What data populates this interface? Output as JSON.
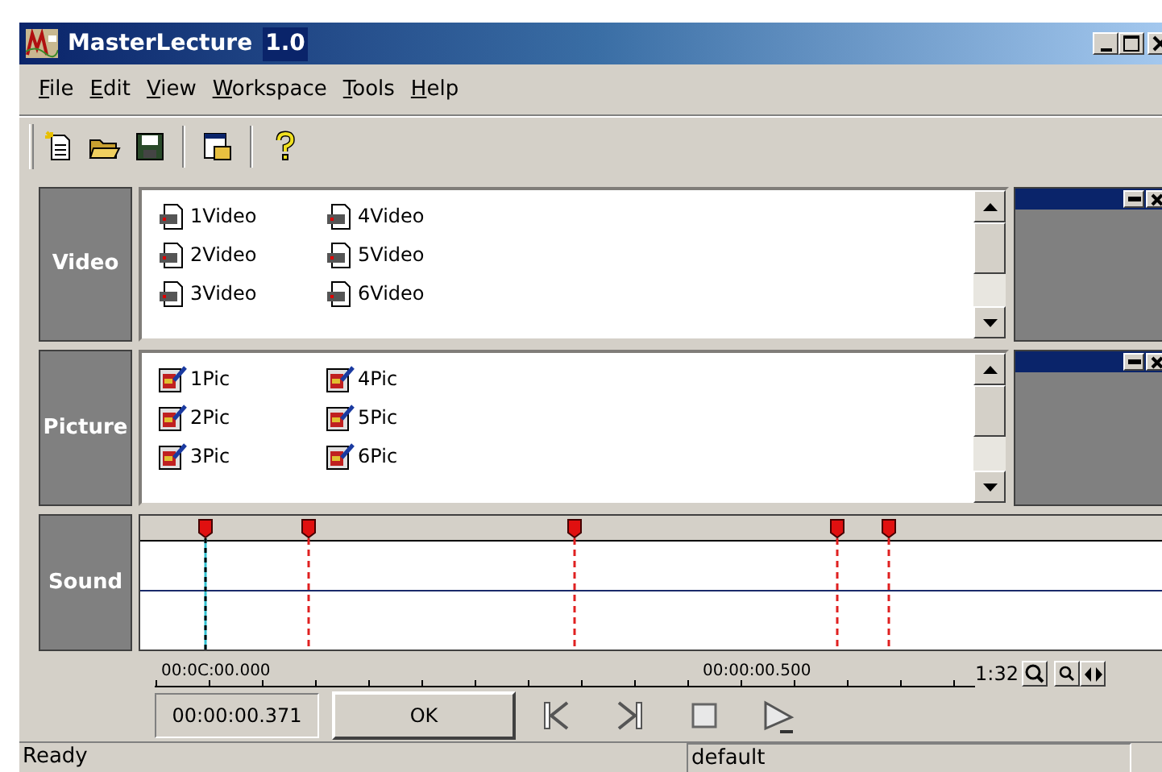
{
  "window": {
    "title": "MasterLecture",
    "version": "1.0"
  },
  "menu": [
    {
      "label": "File"
    },
    {
      "label": "Edit"
    },
    {
      "label": "View"
    },
    {
      "label": "Workspace"
    },
    {
      "label": "Tools"
    },
    {
      "label": "Help"
    }
  ],
  "tracks": [
    {
      "kind": "video",
      "label": "Video",
      "items": [
        "1Video",
        "2Video",
        "3Video",
        "4Video",
        "5Video",
        "6Video"
      ]
    },
    {
      "kind": "picture",
      "label": "Picture",
      "items": [
        "1Pic",
        "2Pic",
        "3Pic",
        "4Pic",
        "5Pic",
        "6Pic"
      ]
    },
    {
      "kind": "sound",
      "label": "Sound"
    }
  ],
  "markers": [
    {
      "selected": true
    },
    {
      "selected": false
    },
    {
      "selected": false
    },
    {
      "selected": false
    },
    {
      "selected": false
    }
  ],
  "ruler": {
    "start": "00:0C:00.000",
    "mid": "00:00:00.500",
    "zoom": "1:32"
  },
  "time_field": {
    "value": "00:00:00.371"
  },
  "ok_button": "OK",
  "status_bar": [
    "Ready",
    "default"
  ]
}
